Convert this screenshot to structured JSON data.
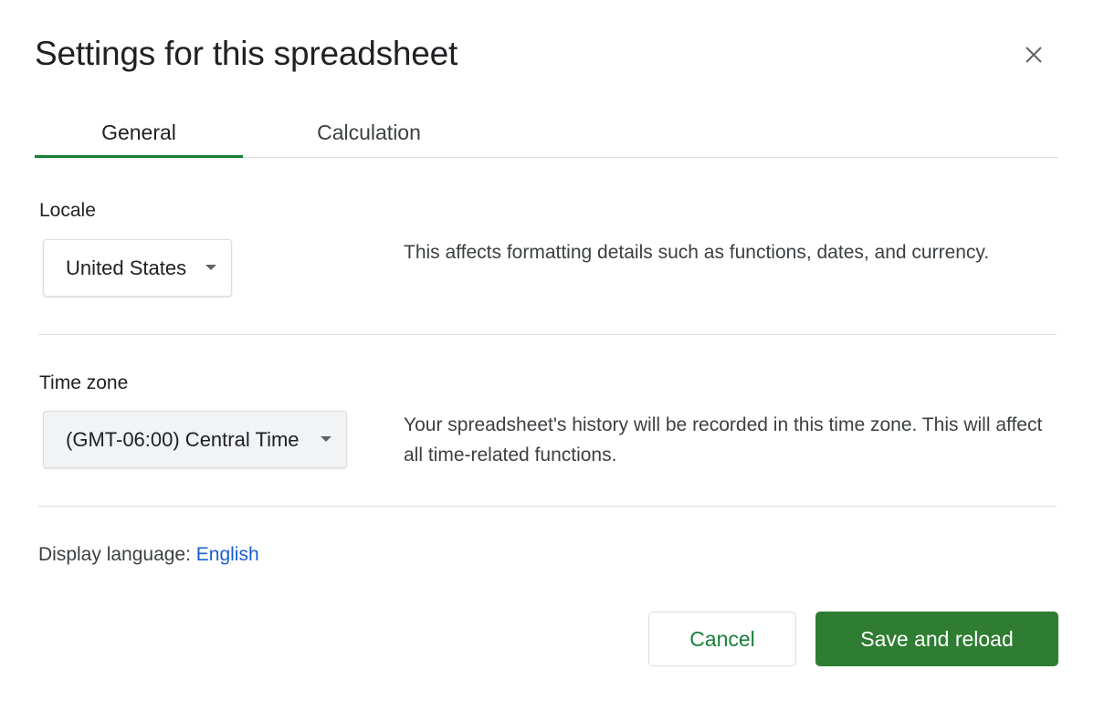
{
  "dialog": {
    "title": "Settings for this spreadsheet"
  },
  "tabs": [
    {
      "label": "General",
      "active": true
    },
    {
      "label": "Calculation",
      "active": false
    }
  ],
  "locale": {
    "label": "Locale",
    "value": "United States",
    "description": "This affects formatting details such as functions, dates, and currency."
  },
  "timezone": {
    "label": "Time zone",
    "value": "(GMT-06:00) Central Time",
    "description": "Your spreadsheet's history will be recorded in this time zone. This will affect all time-related functions."
  },
  "display_language": {
    "prefix": "Display language: ",
    "value": "English"
  },
  "buttons": {
    "cancel": "Cancel",
    "save": "Save and reload"
  },
  "icons": {
    "close": "close-icon",
    "dropdown": "chevron-down-icon"
  },
  "colors": {
    "accent": "#188038",
    "primary_button": "#2e7d32",
    "link": "#1a5fd0"
  }
}
